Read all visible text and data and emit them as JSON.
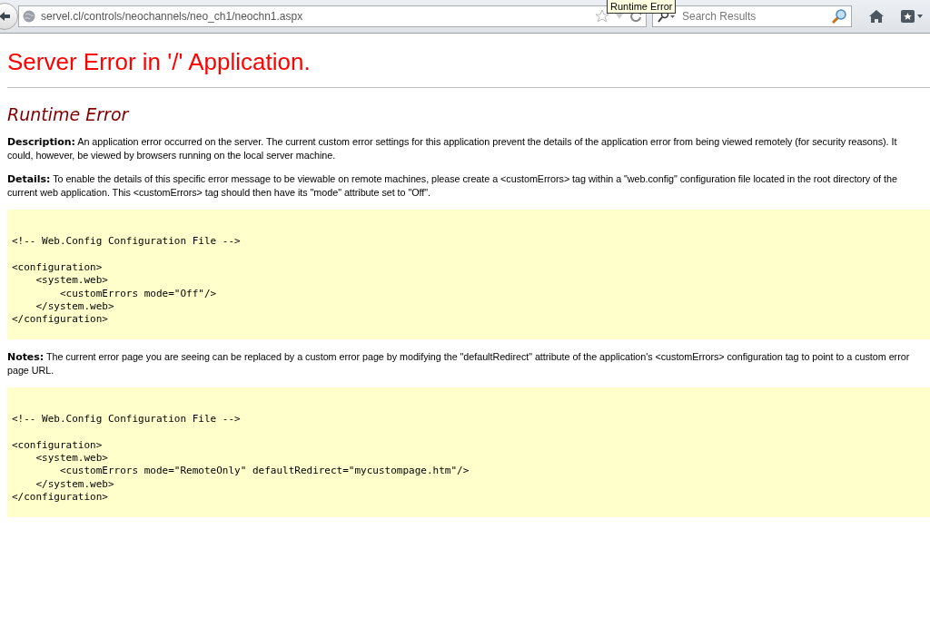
{
  "browser": {
    "url": "servel.cl/controls/neochannels/neo_ch1/neochn1.aspx",
    "search": {
      "placeholder": "Search Results"
    },
    "tooltip": "Runtime Error"
  },
  "page": {
    "title": "Server Error in '/' Application.",
    "subtitle": "Runtime Error",
    "sections": [
      {
        "kind": "paragraph",
        "label": "Description:",
        "text": "An application error occurred on the server. The current custom error settings for this application prevent the details of the application error from being viewed remotely (for security reasons). It could, however, be viewed by browsers running on the local server machine."
      },
      {
        "kind": "paragraph",
        "label": "Details:",
        "text": "To enable the details of this specific error message to be viewable on remote machines, please create a <customErrors> tag within a \"web.config\" configuration file located in the root directory of the current web application. This <customErrors> tag should then have its \"mode\" attribute set to \"Off\"."
      },
      {
        "kind": "code",
        "code": "<!-- Web.Config Configuration File -->\n\n<configuration>\n    <system.web>\n        <customErrors mode=\"Off\"/>\n    </system.web>\n</configuration>"
      },
      {
        "kind": "paragraph",
        "label": "Notes:",
        "text": "The current error page you are seeing can be replaced by a custom error page by modifying the \"defaultRedirect\" attribute of the application's <customErrors> configuration tag to point to a custom error page URL."
      },
      {
        "kind": "code",
        "code": "<!-- Web.Config Configuration File -->\n\n<configuration>\n    <system.web>\n        <customErrors mode=\"RemoteOnly\" defaultRedirect=\"mycustompage.htm\"/>\n    </system.web>\n</configuration>"
      }
    ]
  }
}
